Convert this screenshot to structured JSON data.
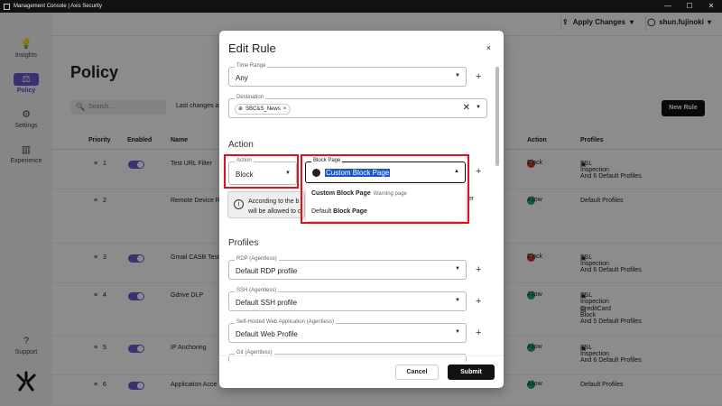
{
  "window": {
    "title": "Management Console | Axis Security",
    "min": "—",
    "max": "☐",
    "close": "✕"
  },
  "sidebar": {
    "items": [
      {
        "label": "Insights",
        "icon": "lightbulb-icon"
      },
      {
        "label": "Policy",
        "icon": "policy-icon",
        "active": true
      },
      {
        "label": "Settings",
        "icon": "gear-icon"
      },
      {
        "label": "Experience",
        "icon": "chart-icon"
      },
      {
        "label": "Support",
        "icon": "help-icon"
      }
    ]
  },
  "topbar": {
    "apply_label": "Apply Changes",
    "user_name": "shun.fujinoki"
  },
  "page": {
    "title": "Policy",
    "search_placeholder": "Search...",
    "last_changes": "Last changes ap",
    "new_rule_label": "New Rule"
  },
  "table": {
    "headers": [
      "Priority",
      "Enabled",
      "Name",
      "Action",
      "Profiles"
    ],
    "rows": [
      {
        "priority": "1",
        "name": "Test URL Filter",
        "action": "Block",
        "profiles": [
          "SSL Inspection",
          "And 6 Default Profiles"
        ]
      },
      {
        "priority": "2",
        "name": "Remote Device R",
        "action": "Allow",
        "profiles": [
          "Default Profiles"
        ]
      },
      {
        "priority": "3",
        "name": "Gmail CASB Test",
        "action": "Block",
        "profiles": [
          "SSL Inspection",
          "And 6 Default Profiles"
        ]
      },
      {
        "priority": "4",
        "name": "Gdrive DLP",
        "action": "Allow",
        "profiles": [
          "SSL Inspection",
          "CreditCard Block",
          "And 5 Default Profiles"
        ]
      },
      {
        "priority": "5",
        "name": "IP Anchoring",
        "action": "Allow",
        "profiles": [
          "SSL Inspection",
          "And 6 Default Profiles"
        ]
      },
      {
        "priority": "6",
        "name": "Application Acce",
        "action": "Allow",
        "profiles": [
          "Default Profiles"
        ]
      }
    ]
  },
  "modal": {
    "title": "Edit Rule",
    "close": "×",
    "time_range": {
      "label": "Time Range",
      "value": "Any"
    },
    "destination": {
      "label": "Destination",
      "chip": "SBC&S_News"
    },
    "action_section": "Action",
    "action": {
      "label": "Action",
      "value": "Block"
    },
    "block_page": {
      "label": "Block Page",
      "value": "Custom Block Page"
    },
    "dropdown": {
      "opt1_main": "Custom Block Page",
      "opt1_sub": "Warning page",
      "opt2_prefix": "Default",
      "opt2_main": "Block Page"
    },
    "info": {
      "line1": "According to the b",
      "line2": "will be allowed to c",
      "line1_tail": "er"
    },
    "profiles_section": "Profiles",
    "rdp": {
      "label": "RDP (Agentless)",
      "value": "Default RDP profile"
    },
    "ssh": {
      "label": "SSH (Agentless)",
      "value": "Default SSH profile"
    },
    "web": {
      "label": "Self-Hosted Web Application (Agentless)",
      "value": "Default Web Profile"
    },
    "git": {
      "label": "Git (Agentless)"
    },
    "cancel_label": "Cancel",
    "submit_label": "Submit"
  },
  "colors": {
    "accent": "#6a5acd",
    "highlight": "#e0101e",
    "block": "#d0302a",
    "allow": "#1aa37a"
  }
}
